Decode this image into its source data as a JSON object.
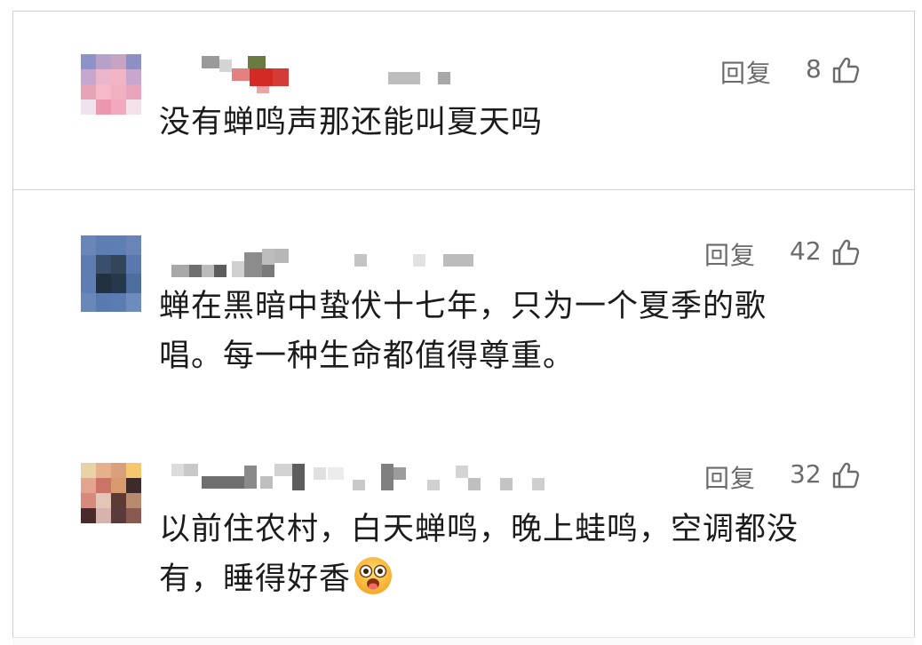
{
  "comments": [
    {
      "reply_label": "回复",
      "likes": "8",
      "text_lines": [
        "没有蝉鸣声那还能叫夏天吗"
      ]
    },
    {
      "reply_label": "回复",
      "likes": "42",
      "text_lines": [
        "蝉在黑暗中蛰伏十七年，只为一个夏季的歌",
        "唱。每一种生命都值得尊重。"
      ]
    },
    {
      "reply_label": "回复",
      "likes": "32",
      "text_lines": [
        "以前住农村，白天蝉鸣，晚上蛙鸣，空调都没",
        "有，睡得好香"
      ]
    }
  ],
  "icons": {
    "like": "thumbs-up-icon",
    "emoji": "drooling-face-emoji"
  },
  "colors": {
    "text": "#1b1b1b",
    "meta": "#6b6b6b",
    "border": "#cfcfcf"
  }
}
